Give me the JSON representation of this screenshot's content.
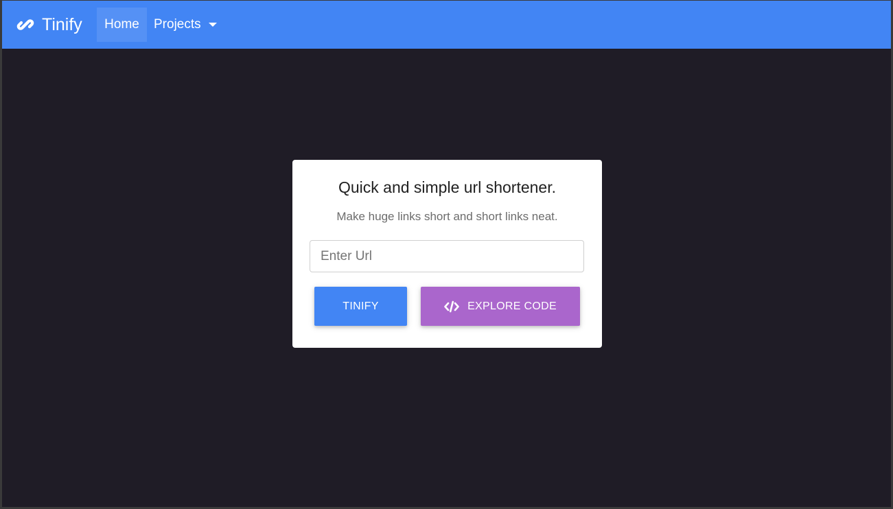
{
  "navbar": {
    "brand_icon": "link-icon",
    "brand_name": "Tinify",
    "home_label": "Home",
    "projects_label": "Projects",
    "projects_caret_icon": "caret-down-icon",
    "background_color": "#4285f4"
  },
  "card": {
    "title": "Quick and simple url shortener.",
    "subtitle": "Make huge links short and short links neat.",
    "url_input": {
      "placeholder": "Enter Url",
      "value": ""
    },
    "tinify_button": {
      "label": "TINIFY",
      "color": "#4285f4"
    },
    "explore_button": {
      "icon": "code-icon",
      "label": "EXPLORE CODE",
      "color": "#aa66cc"
    }
  },
  "page": {
    "background_color": "#1f1c26"
  }
}
